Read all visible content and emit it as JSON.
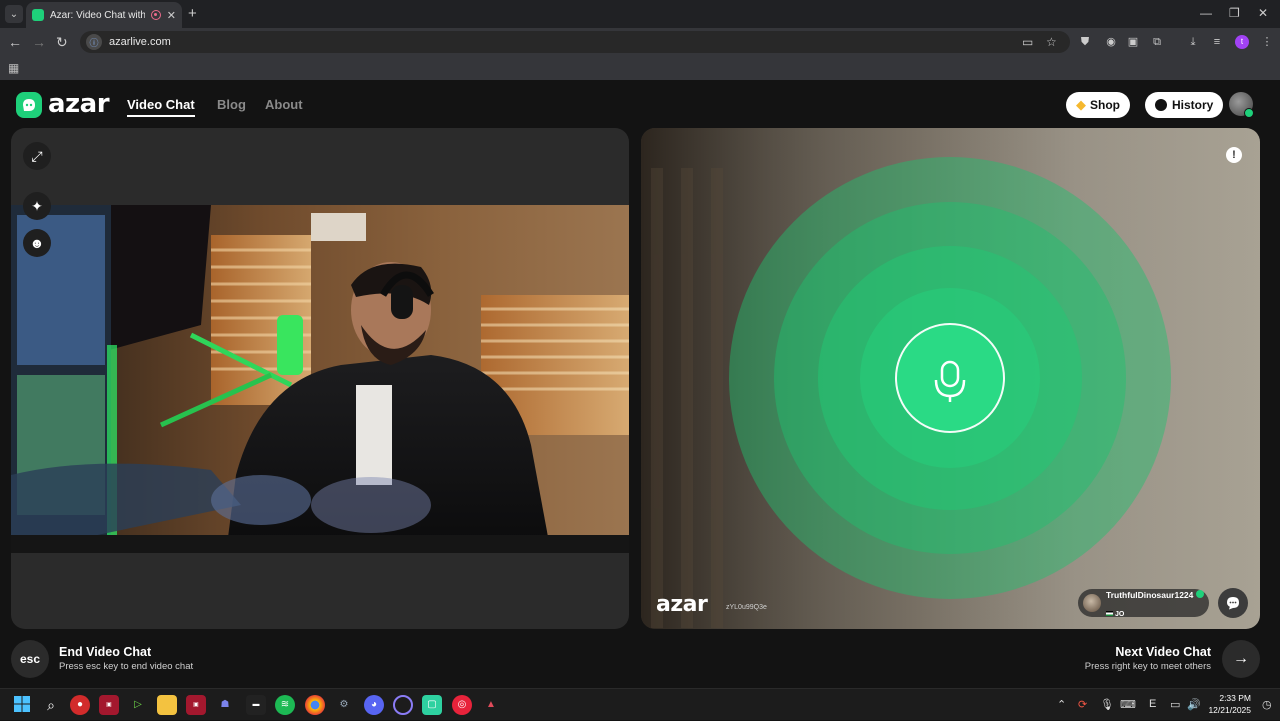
{
  "browser": {
    "tab_title": "Azar: Video Chat with New",
    "url": "azarlive.com"
  },
  "site": {
    "logo_text": "azar",
    "nav": {
      "video_chat": "Video Chat",
      "blog": "Blog",
      "about": "About"
    },
    "shop_label": "Shop",
    "history_label": "History"
  },
  "remote": {
    "watermark": "azar",
    "room_code": "zYL0u99Q3e",
    "partner_name": "TruthfulDinosaur1224",
    "partner_country": "JO"
  },
  "controls": {
    "esc_key": "esc",
    "end_title": "End Video Chat",
    "end_sub": "Press esc key to end video chat",
    "next_title": "Next Video Chat",
    "next_sub": "Press right key to meet others"
  },
  "taskbar": {
    "time": "2:33 PM",
    "date": "12/21/2025",
    "tray_lang": "E"
  },
  "colors": {
    "brand_green": "#1ed07a",
    "panel_bg": "#2b2b2b",
    "page_bg": "#131313"
  }
}
